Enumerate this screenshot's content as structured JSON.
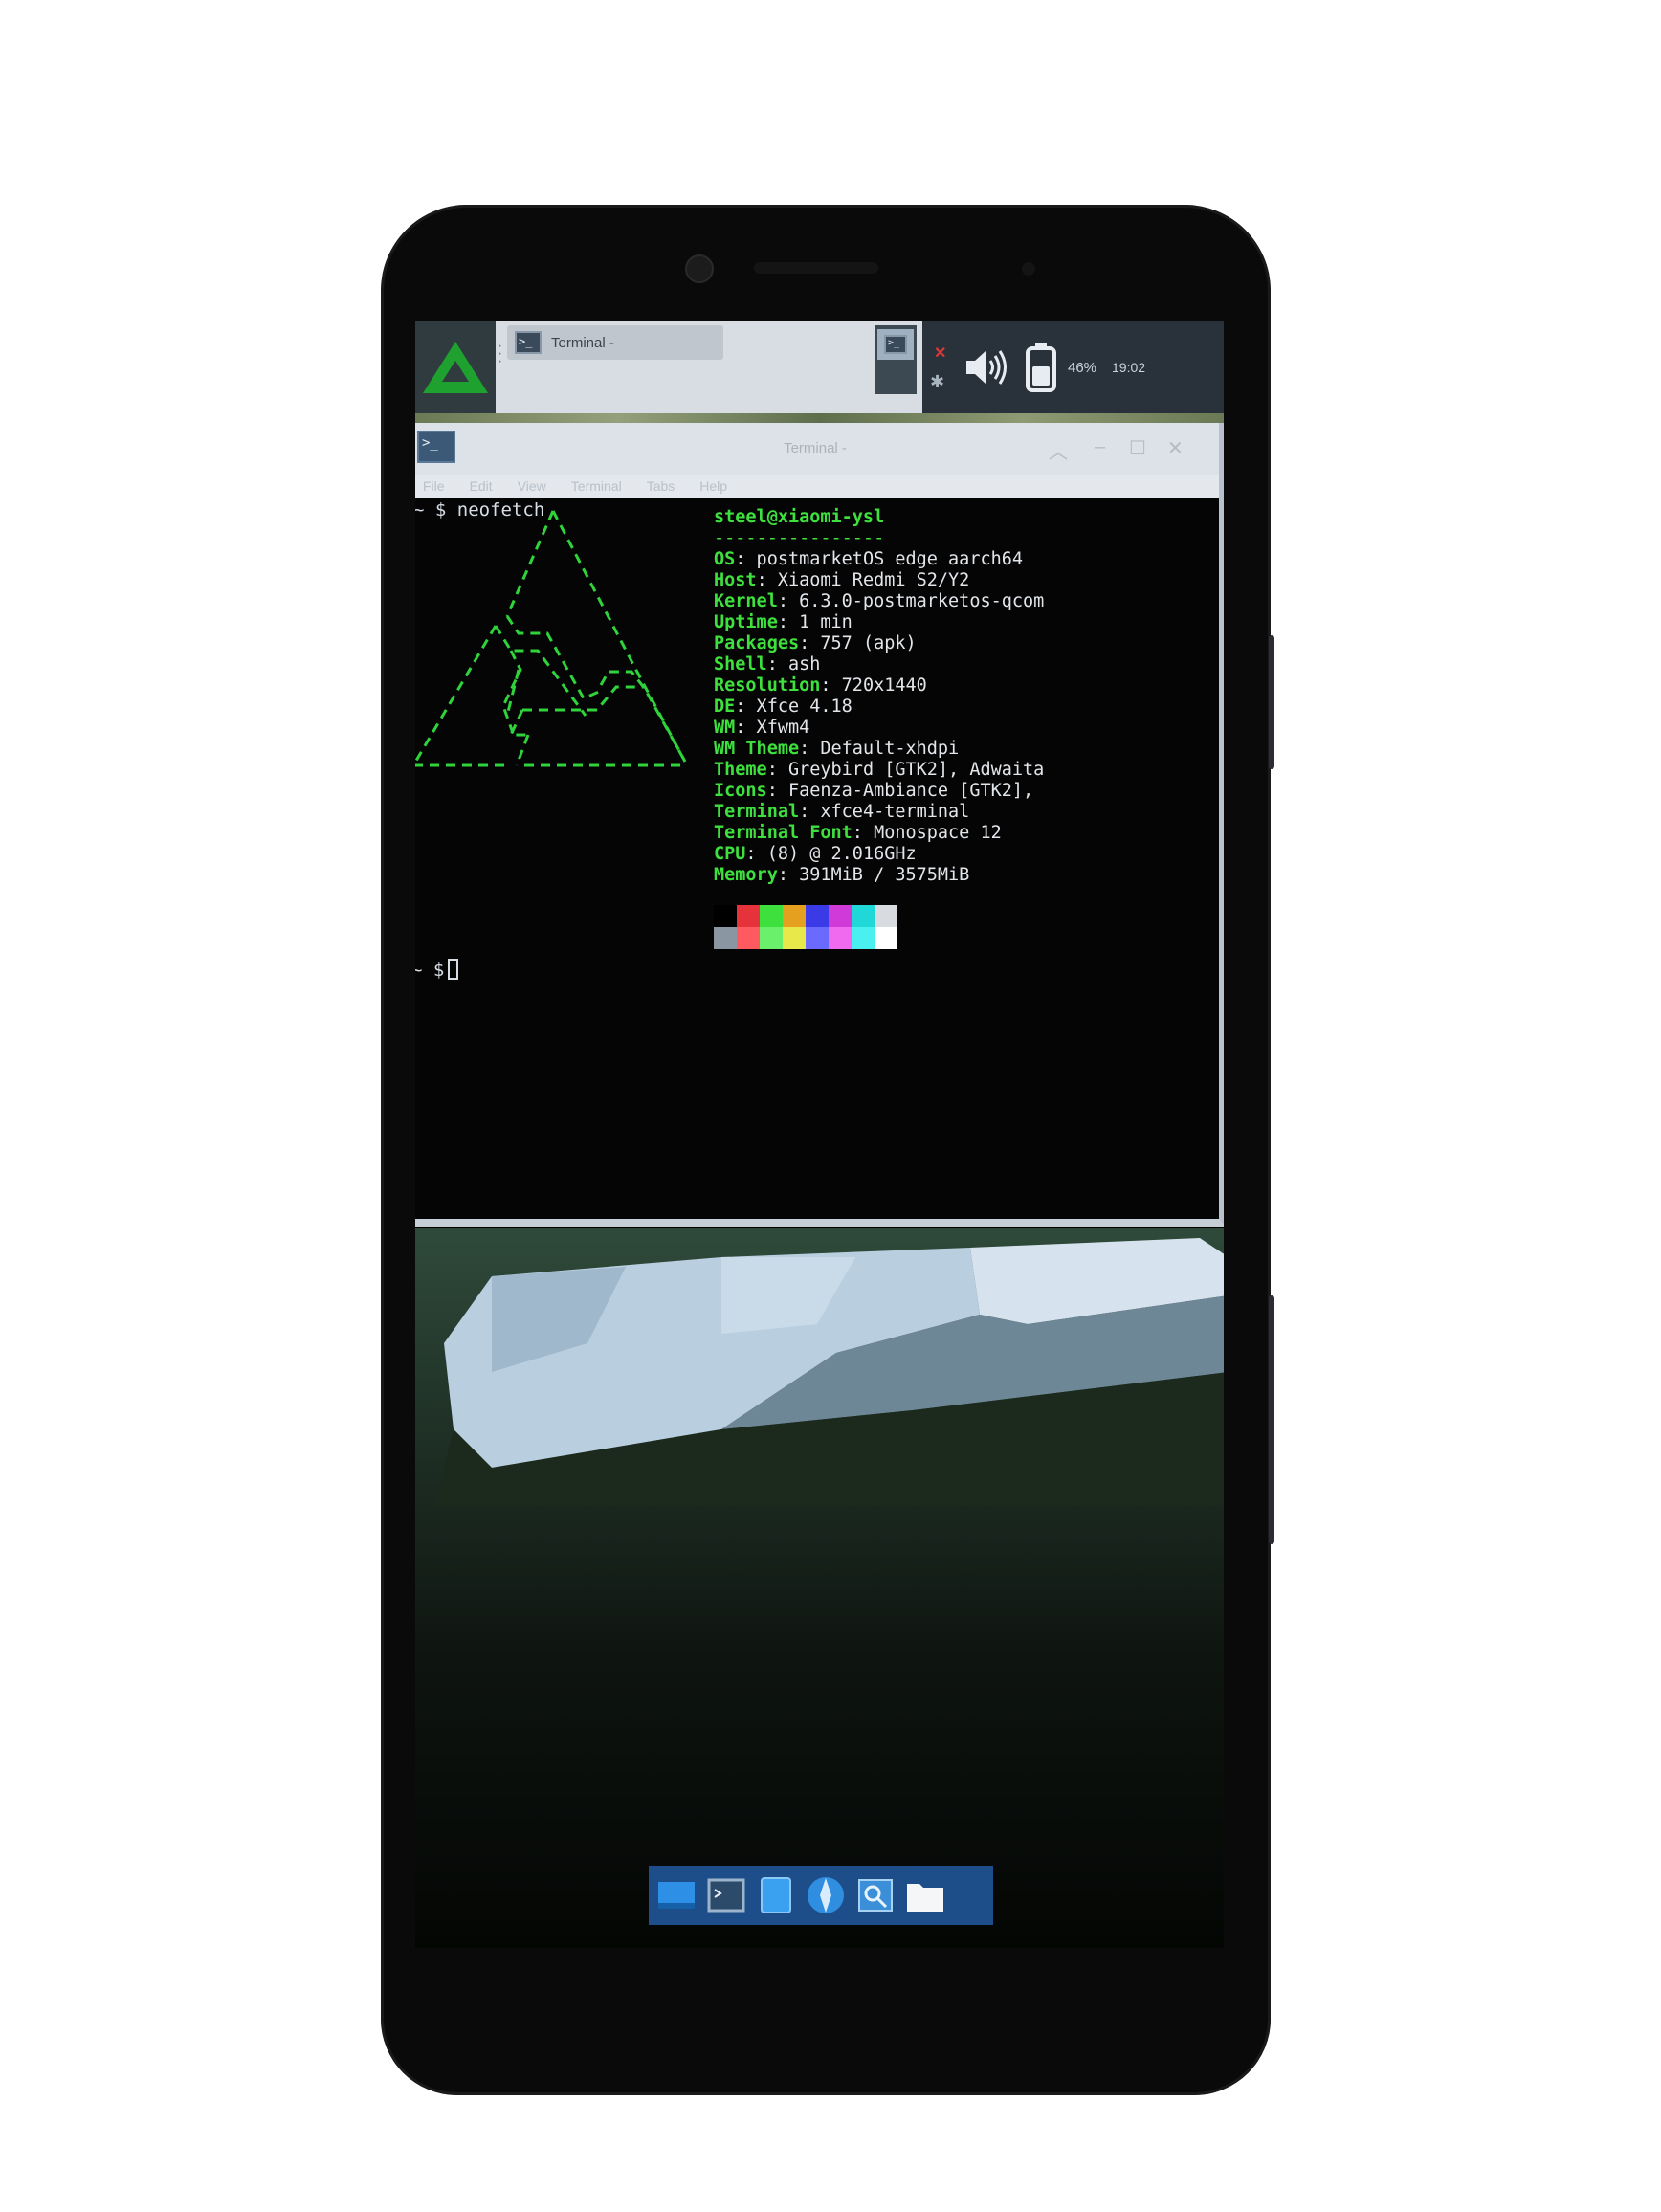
{
  "panel": {
    "task_label": "Terminal -",
    "battery": "46%",
    "clock": "19:02",
    "icons": [
      "postmarketos-logo-icon",
      "terminal-icon",
      "network-offline-icon",
      "bluetooth-icon",
      "volume-icon",
      "battery-icon"
    ],
    "accent": "#1fa12f"
  },
  "window": {
    "title": "Terminal -",
    "menu": [
      "File",
      "Edit",
      "View",
      "Terminal",
      "Tabs",
      "Help"
    ]
  },
  "terminal": {
    "prompt1": "~ $ neofetch",
    "user_host": "steel@xiaomi-ysl",
    "separator": "----------------",
    "info": [
      {
        "key": "OS",
        "value": " postmarketOS edge aarch64"
      },
      {
        "key": "Host",
        "value": " Xiaomi Redmi S2/Y2"
      },
      {
        "key": "Kernel",
        "value": " 6.3.0-postmarketos-qcom"
      },
      {
        "key": "Uptime",
        "value": " 1 min"
      },
      {
        "key": "Packages",
        "value": " 757 (apk)"
      },
      {
        "key": "Shell",
        "value": " ash"
      },
      {
        "key": "Resolution",
        "value": " 720x1440"
      },
      {
        "key": "DE",
        "value": " Xfce 4.18"
      },
      {
        "key": "WM",
        "value": " Xfwm4"
      },
      {
        "key": "WM Theme",
        "value": " Default-xhdpi"
      },
      {
        "key": "Theme",
        "value": " Greybird [GTK2], Adwaita"
      },
      {
        "key": "Icons",
        "value": " Faenza-Ambiance [GTK2],"
      },
      {
        "key": "Terminal",
        "value": " xfce4-terminal"
      },
      {
        "key": "Terminal Font",
        "value": " Monospace 12"
      },
      {
        "key": "CPU",
        "value": " (8) @ 2.016GHz"
      },
      {
        "key": "Memory",
        "value": " 391MiB / 3575MiB"
      }
    ],
    "prompt2": "~ $",
    "palette_top": [
      "#000000",
      "#e6323a",
      "#3ee03e",
      "#e6a020",
      "#3a3ae6",
      "#d03ad8",
      "#20d8d8",
      "#d8dce0"
    ],
    "palette_bottom": [
      "#8a96a2",
      "#ff5a60",
      "#6af06a",
      "#e8e84a",
      "#6a6aff",
      "#f06af0",
      "#4af0f0",
      "#ffffff"
    ],
    "logo_color": "#2fd33a"
  },
  "dock": {
    "icons": [
      "show-desktop-icon",
      "terminal-icon",
      "files-icon",
      "web-browser-icon",
      "app-finder-icon",
      "folder-icon"
    ]
  }
}
